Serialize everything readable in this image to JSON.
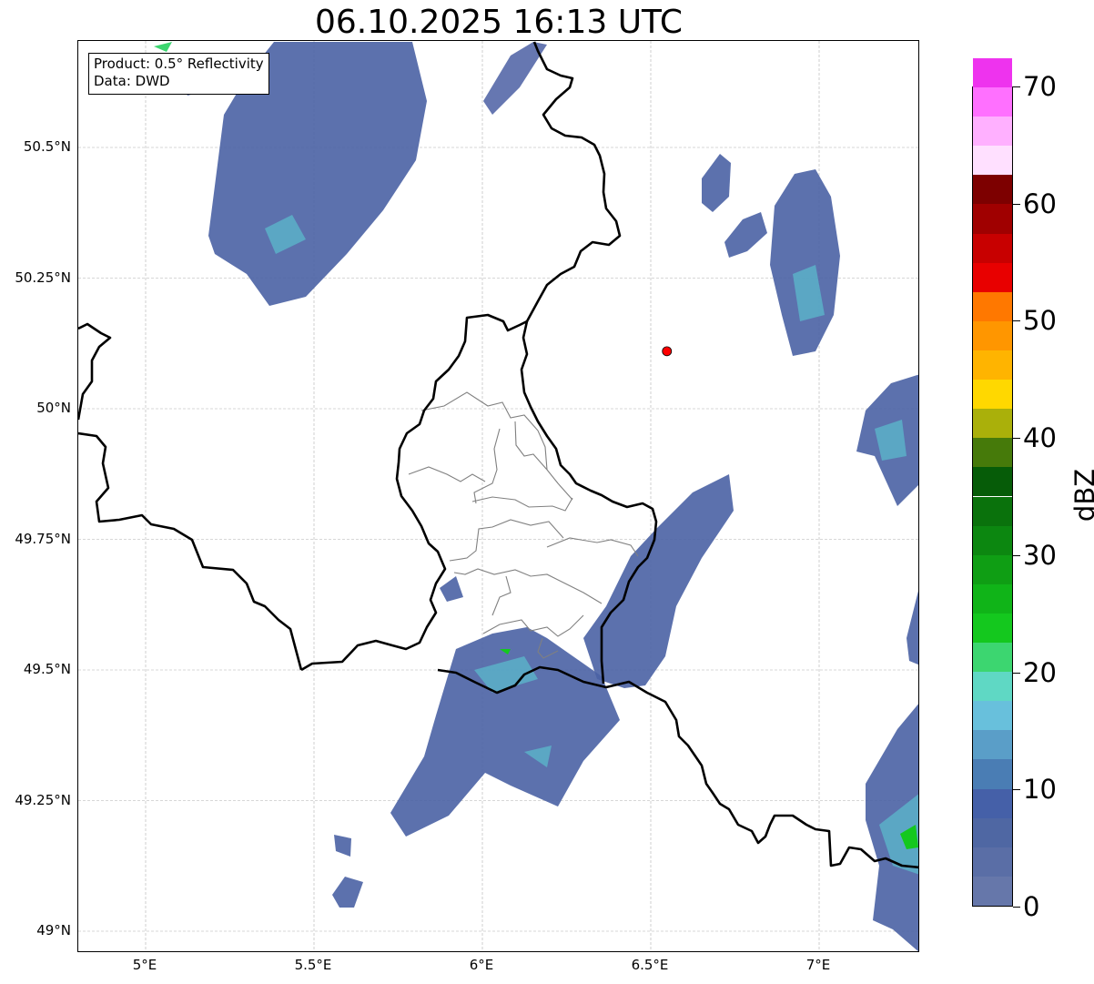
{
  "title": "06.10.2025 16:13 UTC",
  "info_box": {
    "product": "Product: 0.5° Reflectivity",
    "source": "Data: DWD"
  },
  "map": {
    "lon_range": [
      4.8,
      7.3
    ],
    "lat_range": [
      48.95,
      50.72
    ],
    "lat_ticks": [
      {
        "value": 50.5,
        "label": "50.5°N"
      },
      {
        "value": 50.25,
        "label": "50.25°N"
      },
      {
        "value": 50.0,
        "label": "50°N"
      },
      {
        "value": 49.75,
        "label": "49.75°N"
      },
      {
        "value": 49.5,
        "label": "49.5°N"
      },
      {
        "value": 49.25,
        "label": "49.25°N"
      },
      {
        "value": 49.0,
        "label": "49°N"
      }
    ],
    "lon_ticks": [
      {
        "value": 5.0,
        "label": "5°E"
      },
      {
        "value": 5.5,
        "label": "5.5°E"
      },
      {
        "value": 6.0,
        "label": "6°E"
      },
      {
        "value": 6.5,
        "label": "6.5°E"
      },
      {
        "value": 7.0,
        "label": "7°E"
      }
    ],
    "radar_site": {
      "lon": 6.548,
      "lat": 50.11,
      "color": "#ff0000"
    },
    "grid": true,
    "border_color": "#000000",
    "admin_border_color": "#808080"
  },
  "colorbar": {
    "unit": "dBZ",
    "min": 0,
    "max": 70,
    "step": 2.5,
    "tick_labels": [
      "0",
      "10",
      "20",
      "30",
      "40",
      "50",
      "60",
      "70"
    ],
    "colors": [
      "#6677aa",
      "#5a6ea6",
      "#4f67a3",
      "#4560a8",
      "#4a7db4",
      "#5a9ec8",
      "#68c0dc",
      "#5fd8c4",
      "#3cd670",
      "#14c81e",
      "#10b418",
      "#0f9e14",
      "#0c8710",
      "#0a720c",
      "#065c08",
      "#467a0a",
      "#aab00a",
      "#ffd800",
      "#ffb400",
      "#ff9600",
      "#ff7800",
      "#e80000",
      "#c80000",
      "#a00000",
      "#7d0000",
      "#ffe0ff",
      "#ffb0ff",
      "#ff70ff",
      "#ee33ee"
    ]
  }
}
